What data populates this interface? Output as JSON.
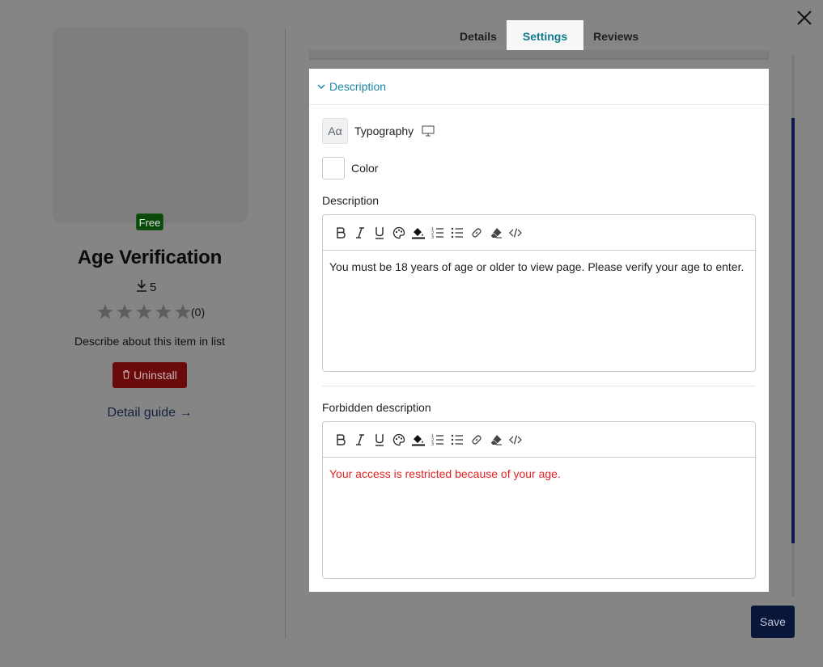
{
  "app": {
    "title": "Age Verification",
    "badge": "Free",
    "downloads": "5",
    "rating_value": 0,
    "rating_count": "(0)",
    "description": "Describe about this item in list",
    "uninstall_label": "Uninstall",
    "detail_guide_label": "Detail guide →"
  },
  "tabs": [
    {
      "label": "Details",
      "active": false
    },
    {
      "label": "Settings",
      "active": true
    },
    {
      "label": "Reviews",
      "active": false
    }
  ],
  "settings": {
    "section_title": "Description",
    "typography_icon_text": "Aα",
    "typography_label": "Typography",
    "color_label": "Color",
    "description_label": "Description",
    "description_value": "You must be 18 years of age or older to view page. Please verify your age to enter.",
    "forbidden_label": "Forbidden description",
    "forbidden_value": "Your access is restricted because of your age.",
    "forbidden_color": "#e02424"
  },
  "toolbar_icons": [
    "bold-icon",
    "italic-icon",
    "underline-icon",
    "palette-icon",
    "fill-color-icon",
    "ordered-list-icon",
    "bullet-list-icon",
    "link-icon",
    "eraser-icon",
    "code-icon"
  ],
  "actions": {
    "save_label": "Save"
  },
  "colors": {
    "accent": "#1a85a6",
    "uninstall": "#6b0a0a",
    "save": "#09163a",
    "free_badge": "#0c4a0c"
  }
}
